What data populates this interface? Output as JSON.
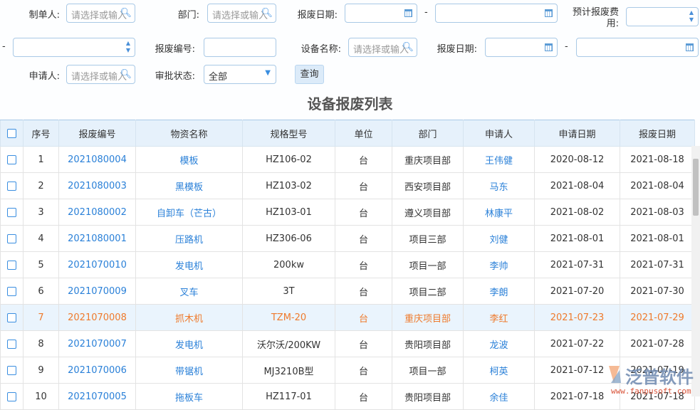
{
  "filters": {
    "creator_label": "制单人:",
    "dept_label": "部门:",
    "scrap_date_label": "报废日期:",
    "est_cost_label": "预计报废费用:",
    "scrap_no_label": "报废编号:",
    "equip_name_label": "设备名称:",
    "scrap_date2_label": "报废日期:",
    "applicant_label": "申请人:",
    "approval_label": "审批状态:",
    "approval_value": "全部",
    "placeholder": "请选择或输入",
    "dash": "-",
    "query_button": "查询"
  },
  "page_title": "设备报废列表",
  "table": {
    "headers": [
      "序号",
      "报废编号",
      "物资名称",
      "规格型号",
      "单位",
      "部门",
      "申请人",
      "申请日期",
      "报废日期"
    ],
    "rows": [
      [
        "1",
        "2021080004",
        "模板",
        "HZ106-02",
        "台",
        "重庆项目部",
        "王伟健",
        "2020-08-12",
        "2021-08-18"
      ],
      [
        "2",
        "2021080003",
        "黑模板",
        "HZ103-02",
        "台",
        "西安项目部",
        "马东",
        "2021-08-04",
        "2021-08-04"
      ],
      [
        "3",
        "2021080002",
        "自卸车（芒古）",
        "HZ103-01",
        "台",
        "遵义项目部",
        "林康平",
        "2021-08-02",
        "2021-08-03"
      ],
      [
        "4",
        "2021080001",
        "压路机",
        "HZ306-06",
        "台",
        "项目三部",
        "刘健",
        "2021-08-01",
        "2021-08-01"
      ],
      [
        "5",
        "2021070010",
        "发电机",
        "200kw",
        "台",
        "项目一部",
        "李帅",
        "2021-07-31",
        "2021-07-31"
      ],
      [
        "6",
        "2021070009",
        "叉车",
        "3T",
        "台",
        "项目二部",
        "李朗",
        "2021-07-20",
        "2021-07-30"
      ],
      [
        "7",
        "2021070008",
        "抓木机",
        "TZM-20",
        "台",
        "重庆项目部",
        "李红",
        "2021-07-23",
        "2021-07-29"
      ],
      [
        "8",
        "2021070007",
        "发电机",
        "沃尔沃/200KW",
        "台",
        "贵阳项目部",
        "龙波",
        "2021-07-22",
        "2021-07-28"
      ],
      [
        "9",
        "2021070006",
        "带锯机",
        "MJ3210B型",
        "台",
        "项目一部",
        "柯英",
        "2021-07-12",
        "2021-07-19"
      ],
      [
        "10",
        "2021070005",
        "拖板车",
        "HZ117-01",
        "台",
        "贵阳项目部",
        "余佳",
        "2021-07-18",
        "2021-07-18"
      ]
    ],
    "highlighted_row": 7
  },
  "watermark": {
    "brand": "泛普软件",
    "url": "www.fanpusoft.com"
  }
}
